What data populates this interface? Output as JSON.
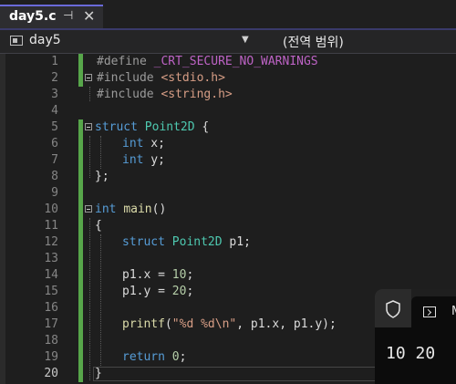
{
  "tab": {
    "title": "day5.c",
    "pin_glyph": "⊣",
    "close_glyph": "✕"
  },
  "nav": {
    "project": "day5",
    "caret": "▼",
    "scope": "(전역 범위)"
  },
  "editor": {
    "current_line": "20",
    "lines": [
      {
        "n": "1"
      },
      {
        "n": "2"
      },
      {
        "n": "3"
      },
      {
        "n": "4"
      },
      {
        "n": "5"
      },
      {
        "n": "6"
      },
      {
        "n": "7"
      },
      {
        "n": "8"
      },
      {
        "n": "9"
      },
      {
        "n": "10"
      },
      {
        "n": "11"
      },
      {
        "n": "12"
      },
      {
        "n": "13"
      },
      {
        "n": "14"
      },
      {
        "n": "15"
      },
      {
        "n": "16"
      },
      {
        "n": "17"
      },
      {
        "n": "18"
      },
      {
        "n": "19"
      },
      {
        "n": "20"
      }
    ],
    "code": {
      "l1": [
        "#define ",
        "_CRT_SECURE_NO_WARNINGS"
      ],
      "l2": [
        "#include ",
        "<stdio.h>"
      ],
      "l3": [
        "#include ",
        "<string.h>"
      ],
      "l5": [
        "struct",
        " ",
        "Point2D",
        " {"
      ],
      "l6": [
        "int",
        " x;"
      ],
      "l7": [
        "int",
        " y;"
      ],
      "l8": [
        "};"
      ],
      "l10": [
        "int",
        " ",
        "main",
        "()"
      ],
      "l11": [
        "{"
      ],
      "l12": [
        "struct",
        " ",
        "Point2D",
        " p1;"
      ],
      "l14": [
        "p1.x = ",
        "10",
        ";"
      ],
      "l15": [
        "p1.y = ",
        "20",
        ";"
      ],
      "l17": [
        "printf",
        "(",
        "\"%d %d\\n\"",
        ", p1.x, p1.y);"
      ],
      "l19": [
        "return",
        " ",
        "0",
        ";"
      ],
      "l20": [
        "}"
      ]
    }
  },
  "console": {
    "tab_label": "M",
    "output": "10 20"
  }
}
